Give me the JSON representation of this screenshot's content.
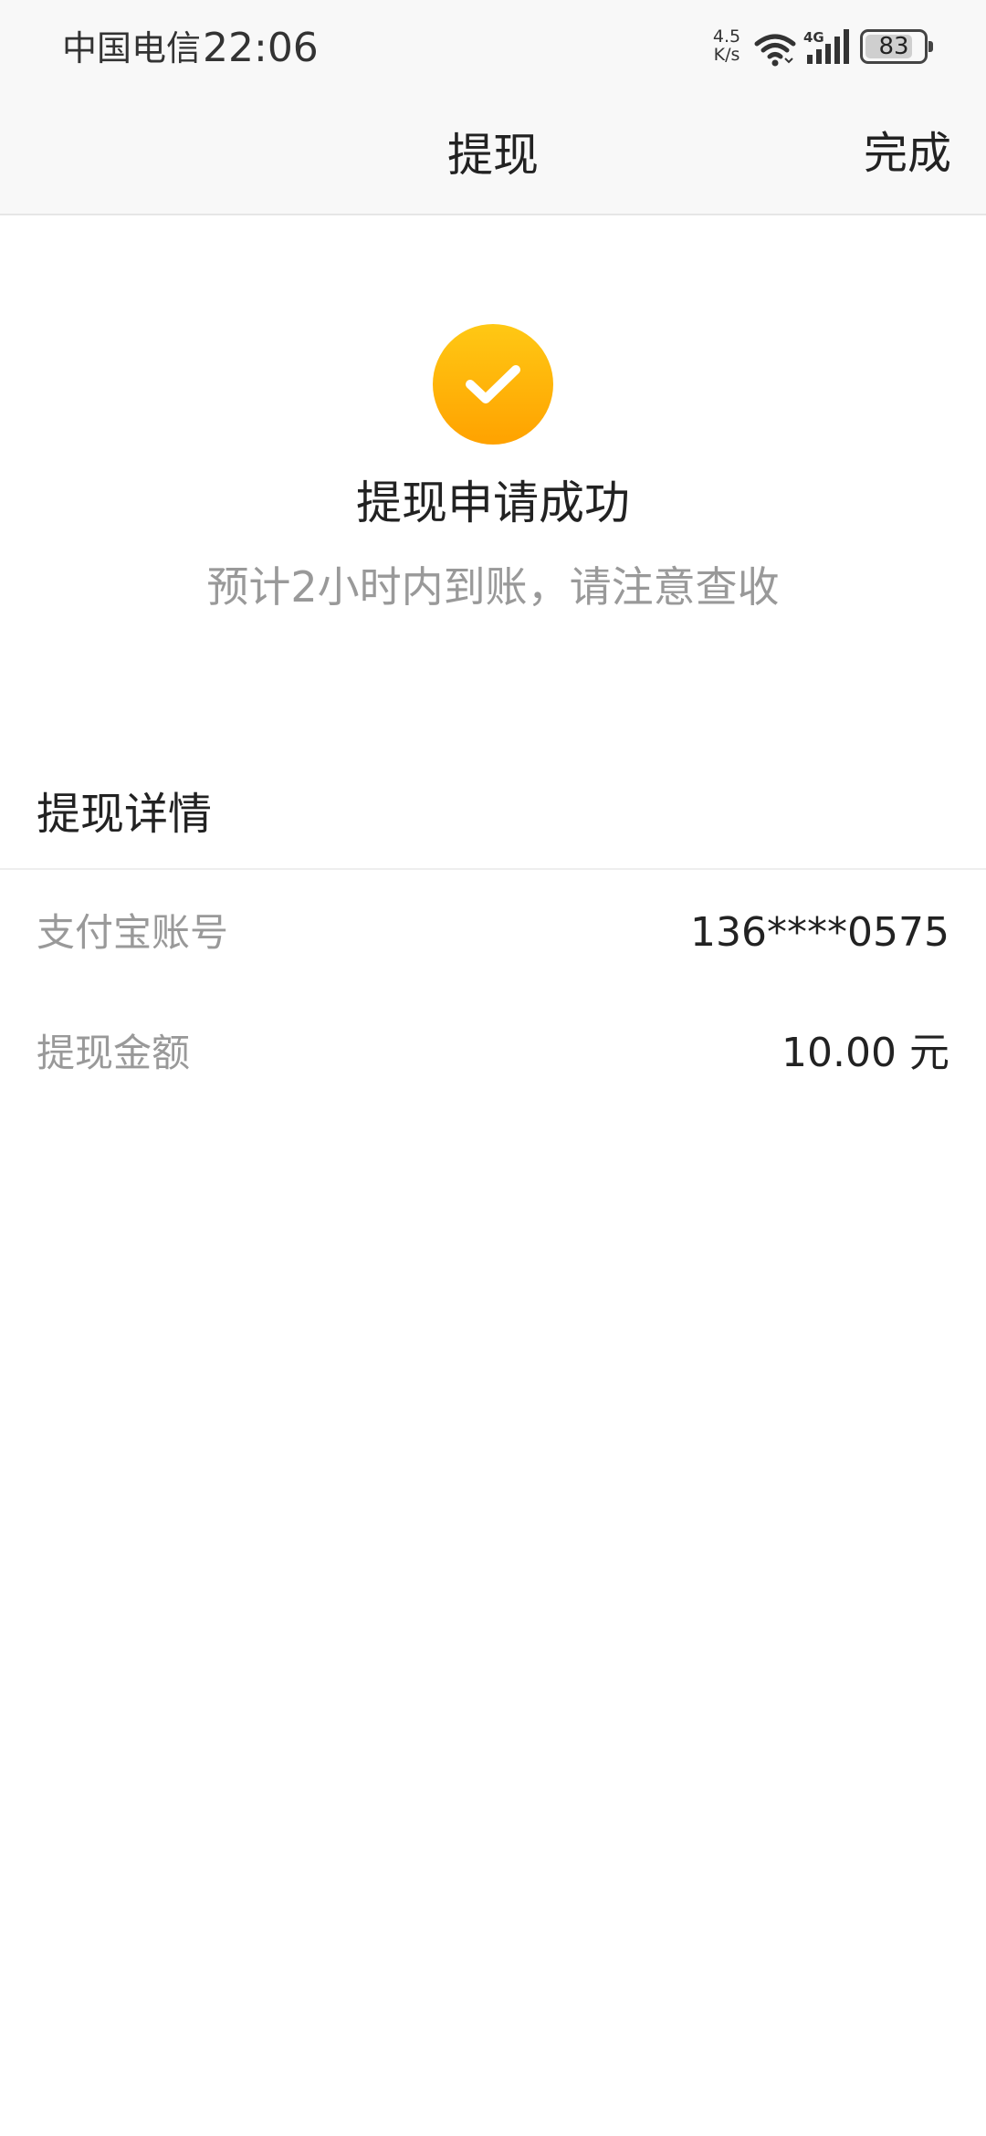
{
  "status_bar": {
    "carrier": "中国电信",
    "time": "22:06",
    "net_speed_value": "4.5",
    "net_speed_unit": "K/s",
    "network_type": "4G",
    "battery_level": "83",
    "battery_fraction": 0.83
  },
  "nav": {
    "title": "提现",
    "done_label": "完成"
  },
  "success": {
    "icon": "check-circle-icon",
    "icon_color": "#ffb000",
    "title": "提现申请成功",
    "subtitle": "预计2小时内到账，请注意查收"
  },
  "details": {
    "header": "提现详情",
    "rows": [
      {
        "label": "支付宝账号",
        "value": "136****0575"
      },
      {
        "label": "提现金额",
        "value": "10.00 元"
      }
    ]
  }
}
